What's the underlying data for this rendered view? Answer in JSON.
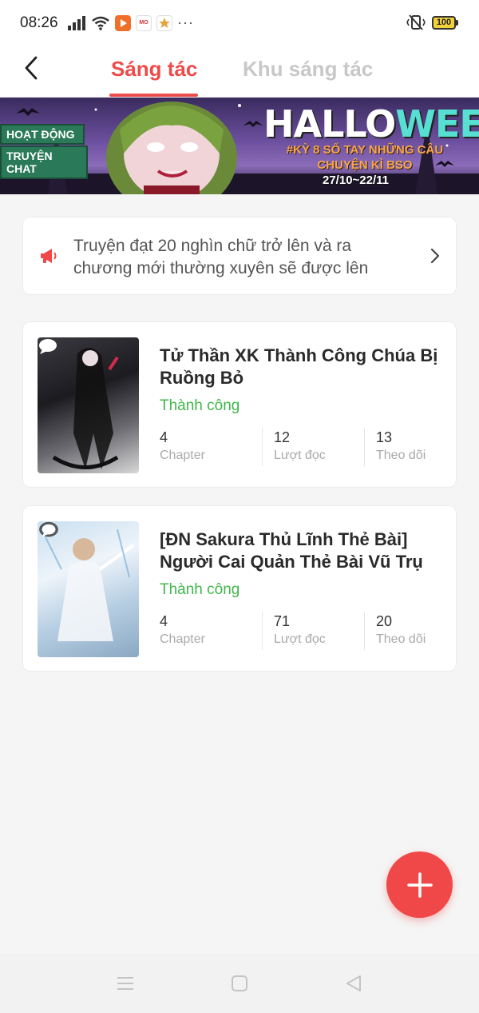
{
  "status_bar": {
    "time": "08:26",
    "battery": "100",
    "icons_left": [
      "signal-icon",
      "wifi-icon",
      "app-video-icon",
      "app-mo-icon",
      "app-star-icon",
      "more-dots-icon"
    ],
    "icons_right": [
      "vibrate-icon",
      "battery-icon"
    ]
  },
  "header": {
    "tabs": [
      {
        "label": "Sáng tác",
        "active": true
      },
      {
        "label": "Khu sáng tác",
        "active": false
      }
    ],
    "accent_color": "#ee4b4b"
  },
  "banner": {
    "badge_1": "HOẠT ĐỘNG",
    "badge_2": "TRUYỆN CHAT",
    "title_part_1": "HALLO",
    "title_part_2": "WEEN",
    "subtitle": "#KỲ 8 SỔ TAY NHỮNG CÂU CHUYỆN KÌ BSO",
    "dates": "27/10~22/11"
  },
  "notice": {
    "text": "Truyện đạt 20 nghìn chữ trở lên và ra chương mới thường xuyên sẽ được lên"
  },
  "stories": [
    {
      "title": "Tử Thần XK Thành Công Chúa Bị Ruồng Bỏ",
      "status": "Thành công",
      "stats": [
        {
          "value": "4",
          "label": "Chapter"
        },
        {
          "value": "12",
          "label": "Lượt đọc"
        },
        {
          "value": "13",
          "label": "Theo dõi"
        }
      ]
    },
    {
      "title": "[ĐN Sakura Thủ Lĩnh Thẻ Bài] Người Cai Quản Thẻ Bài Vũ Trụ",
      "status": "Thành công",
      "stats": [
        {
          "value": "4",
          "label": "Chapter"
        },
        {
          "value": "71",
          "label": "Lượt đọc"
        },
        {
          "value": "20",
          "label": "Theo dõi"
        }
      ]
    }
  ],
  "status_color": "#3fb74b",
  "fab_icon": "plus-icon",
  "nav_icons": [
    "menu-icon",
    "home-square-icon",
    "back-triangle-icon"
  ]
}
